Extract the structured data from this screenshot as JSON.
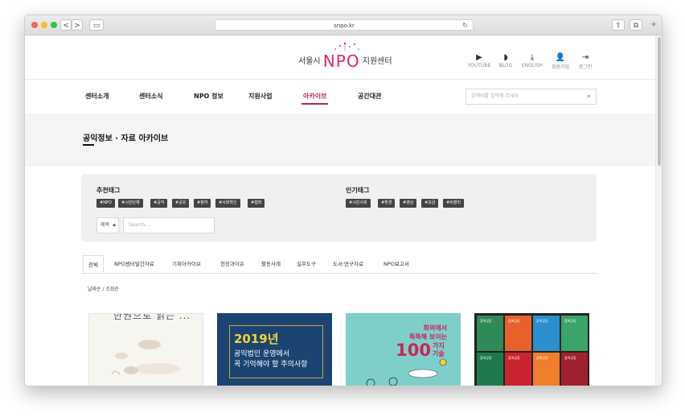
{
  "browser": {
    "url": "snpo.kr",
    "back": "<",
    "forward": ">",
    "reload": "↻",
    "share": "⇧",
    "tabs": "⧉",
    "new_tab": "+"
  },
  "header": {
    "logo_left": "서울시",
    "logo_mid": "NPO",
    "logo_right": "지원센터",
    "utility": [
      {
        "icon": "youtube-icon",
        "glyph": "▶",
        "label": "YOUTUBE"
      },
      {
        "icon": "rss-icon",
        "glyph": "◗",
        "label": "BLOG"
      },
      {
        "icon": "download-icon",
        "glyph": "⤓",
        "label": "ENGLISH"
      },
      {
        "icon": "add-user-icon",
        "glyph": "👤",
        "label": "회원가입"
      },
      {
        "icon": "login-icon",
        "glyph": "⇥",
        "label": "로그인"
      }
    ]
  },
  "nav": {
    "items": [
      "센터소개",
      "센터소식",
      "NPO 정보",
      "지원사업",
      "아카이브",
      "공간대관"
    ],
    "active": "아카이브",
    "search_placeholder": "검색어를 입력해 주세요"
  },
  "page": {
    "title": "공익정보 · 자료 아카이브"
  },
  "tags": {
    "recommended_heading": "추천태그",
    "recommended": [
      "#NPO",
      "#시민단체",
      "#공익",
      "#공유",
      "#참여",
      "#사회혁신",
      "#협력"
    ],
    "popular_heading": "인기태그",
    "popular": [
      "#시민사회",
      "#환경",
      "#영상",
      "#모금",
      "#비영리"
    ],
    "select_value": "제목",
    "search_placeholder": "Search..."
  },
  "tabs": [
    "전체",
    "NPO센터발간자료",
    "기획아카이브",
    "현장과이슈",
    "활동사례",
    "실무도구",
    "도서·연구자료",
    "NPO보고서"
  ],
  "active_tab": "전체",
  "sort": "날짜순 / 조회순",
  "cards": {
    "card1_title": "한권으로 읽는 ...",
    "card2_year": "2019년",
    "card2_line1": "공익법인 운영에서",
    "card2_line2": "꼭 기억해야 할 주의사항",
    "card3_line1": "회의에서",
    "card3_line2": "똑똑해 보이는",
    "card3_num": "100",
    "card3_unit": "가지 기술",
    "card4_tile": "참여공동"
  },
  "colors": {
    "accent": "#b0245d",
    "logo_pink": "#e0246d",
    "tag_bg": "#444444",
    "card2_bg": "#1b4472",
    "card3_bg": "#7ecfc9"
  }
}
